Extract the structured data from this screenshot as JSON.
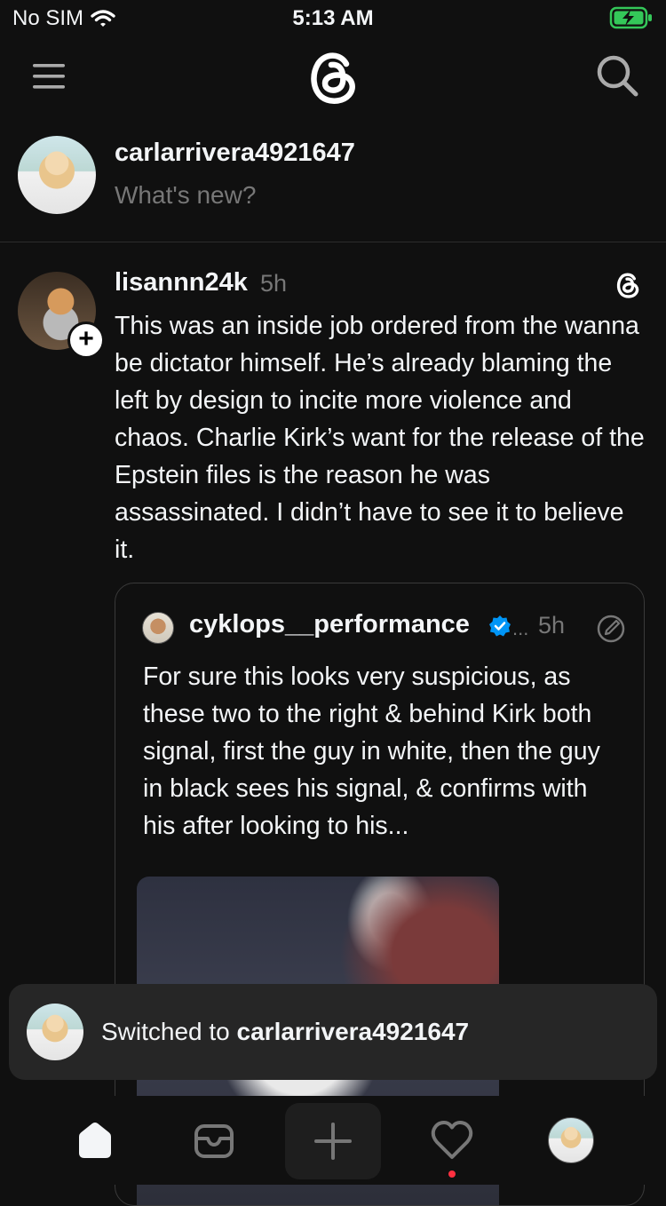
{
  "status_bar": {
    "carrier": "No SIM",
    "time": "5:13 AM"
  },
  "composer": {
    "username": "carlarrivera4921647",
    "placeholder": "What's new?"
  },
  "post": {
    "username": "lisannn24k",
    "time": "5h",
    "text": "This was an inside job ordered from the wanna be dictator himself.  He’s already blaming the left by design to incite more violence and chaos. Charlie Kirk’s want for the release of the Epstein files is the reason he was assassinated. I didn’t have to see it to believe it.",
    "follow_label": "+",
    "quote": {
      "username": "cyklops__performance",
      "dots": "...",
      "time": "5h",
      "text": "For sure this looks very suspicious, as these two to the right & behind Kirk both signal, first the guy in white, then the guy in black sees his signal, & confirms with his after looking to his..."
    }
  },
  "toast": {
    "prefix": "Switched to ",
    "username": "carlarrivera4921647"
  },
  "tabbar": {
    "items": [
      "home-icon",
      "inbox-icon",
      "create-icon",
      "activity-icon",
      "profile-avatar"
    ],
    "activity_dot_color": "#ff3040"
  },
  "colors": {
    "background": "#101010",
    "text": "#f3f5f7",
    "muted": "#777777",
    "verified": "#0095f6",
    "battery": "#34c759"
  }
}
